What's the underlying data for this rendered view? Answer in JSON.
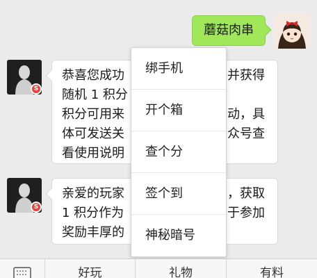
{
  "chat": {
    "sent_message": "蘑菇肉串",
    "message1": {
      "lines": [
        "恭喜您成功",
        "随机 1 积分",
        "积分可用来",
        "体可发送关",
        "看使用说明"
      ],
      "lines_right": [
        "并获得",
        "",
        "动，具",
        "众号查",
        ""
      ]
    },
    "message2": {
      "lines": [
        "亲爱的玩家",
        "1 积分作为",
        "奖励丰厚的"
      ],
      "lines_right": [
        "，获取",
        "于参加",
        ""
      ]
    }
  },
  "popup_menu": {
    "items": [
      {
        "label": "绑手机"
      },
      {
        "label": "开个箱"
      },
      {
        "label": "查个分"
      },
      {
        "label": "签个到"
      },
      {
        "label": "神秘暗号"
      }
    ]
  },
  "bottom_menu": {
    "tabs": [
      {
        "label": "好玩"
      },
      {
        "label": "礼物"
      },
      {
        "label": "有料"
      }
    ]
  },
  "colors": {
    "sent_bubble": "#a0e75a",
    "received_bubble": "#ffffff",
    "background": "#ebebeb",
    "badge": "#e8413a"
  },
  "icons": {
    "keyboard": "keyboard-icon",
    "badge": "s-logo-badge"
  }
}
